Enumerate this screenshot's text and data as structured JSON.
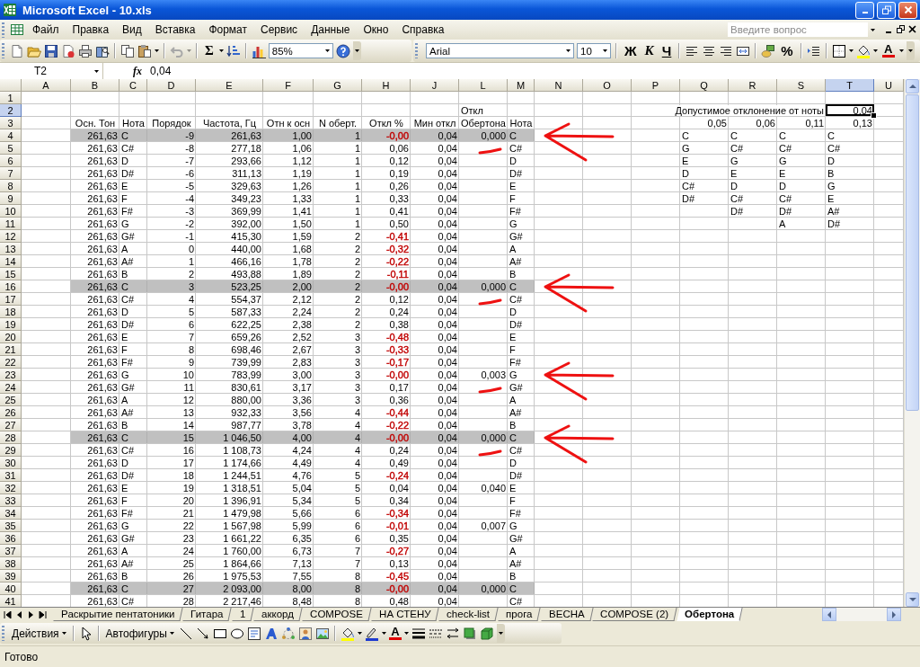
{
  "window": {
    "title": "Microsoft Excel - 10.xls"
  },
  "menu": {
    "items": [
      "Файл",
      "Правка",
      "Вид",
      "Вставка",
      "Формат",
      "Сервис",
      "Данные",
      "Окно",
      "Справка"
    ],
    "help_field": {
      "placeholder": "Введите вопрос"
    }
  },
  "standard_toolbar": {
    "undo_disabled": true,
    "sum": "Σ",
    "zoom": "85%"
  },
  "formatting_toolbar": {
    "font": "Arial",
    "size": "10",
    "bold": "Ж",
    "italic": "К",
    "underline": "Ч",
    "percent": "%",
    "font_color": "A"
  },
  "formula_bar": {
    "name_box": "T2",
    "function_symbol": "fx",
    "formula": "0,04"
  },
  "sheet": {
    "columns": [
      {
        "label": "A",
        "selected": false
      },
      {
        "label": "B",
        "selected": false
      },
      {
        "label": "C",
        "selected": false
      },
      {
        "label": "D",
        "selected": false
      },
      {
        "label": "E",
        "selected": false
      },
      {
        "label": "F",
        "selected": false
      },
      {
        "label": "G",
        "selected": false
      },
      {
        "label": "H",
        "selected": false
      },
      {
        "label": "J",
        "selected": false
      },
      {
        "label": "L",
        "selected": false
      },
      {
        "label": "M",
        "selected": false
      },
      {
        "label": "N",
        "selected": false
      },
      {
        "label": "O",
        "selected": false
      },
      {
        "label": "P",
        "selected": false
      },
      {
        "label": "Q",
        "selected": false
      },
      {
        "label": "R",
        "selected": false
      },
      {
        "label": "S",
        "selected": false
      },
      {
        "label": "T",
        "selected": true
      },
      {
        "label": "U",
        "selected": false
      }
    ],
    "rows": [
      {
        "number": "1",
        "selected": false,
        "highlighted": false
      },
      {
        "number": "2",
        "kind": "data",
        "selected": true,
        "highlighted": false,
        "cells": {
          "L": "Откл",
          "S": "Допустимое отклонение от ноты",
          "T": "0,04"
        }
      },
      {
        "number": "3",
        "kind": "header",
        "selected": false,
        "highlighted": false,
        "cells": {
          "B": "Осн. Тон",
          "C": "Нота",
          "D": "Порядок",
          "E": "Частота, Гц",
          "F": "Отн к осн",
          "G": "N оберт.",
          "H": "Откл %",
          "J": "Мин откл",
          "L": "Обертона",
          "M": "Нота",
          "Q": "0,05",
          "R": "0,06",
          "S": "0,11",
          "T": "0,13"
        }
      },
      {
        "number": "4",
        "kind": "data",
        "selected": false,
        "highlighted": true,
        "annotation": {
          "kind": "arrow"
        },
        "cells": {
          "B": "261,63",
          "C": "C",
          "D": "-9",
          "E": "261,63",
          "F": "1,00",
          "G": "1",
          "H": {
            "text": "-0,00",
            "color": "#c00000"
          },
          "J": "0,04",
          "L": "0,000",
          "M": "C",
          "Q": "C",
          "R": "C",
          "S": "C",
          "T": "C"
        }
      },
      {
        "number": "5",
        "kind": "data",
        "selected": false,
        "highlighted": false,
        "annotation": {
          "kind": "dash"
        },
        "cells": {
          "B": "261,63",
          "C": "C#",
          "D": "-8",
          "E": "277,18",
          "F": "1,06",
          "G": "1",
          "H": "0,06",
          "J": "0,04",
          "M": "C#",
          "Q": "G",
          "R": "C#",
          "S": "C#",
          "T": "C#"
        }
      },
      {
        "number": "6",
        "kind": "data",
        "selected": false,
        "highlighted": false,
        "cells": {
          "B": "261,63",
          "C": "D",
          "D": "-7",
          "E": "293,66",
          "F": "1,12",
          "G": "1",
          "H": "0,12",
          "J": "0,04",
          "M": "D",
          "Q": "E",
          "R": "G",
          "S": "G",
          "T": "D"
        }
      },
      {
        "number": "7",
        "kind": "data",
        "selected": false,
        "highlighted": false,
        "cells": {
          "B": "261,63",
          "C": "D#",
          "D": "-6",
          "E": "311,13",
          "F": "1,19",
          "G": "1",
          "H": "0,19",
          "J": "0,04",
          "M": "D#",
          "Q": "D",
          "R": "E",
          "S": "E",
          "T": "B"
        }
      },
      {
        "number": "8",
        "kind": "data",
        "selected": false,
        "highlighted": false,
        "cells": {
          "B": "261,63",
          "C": "E",
          "D": "-5",
          "E": "329,63",
          "F": "1,26",
          "G": "1",
          "H": "0,26",
          "J": "0,04",
          "M": "E",
          "Q": "C#",
          "R": "D",
          "S": "D",
          "T": "G"
        }
      },
      {
        "number": "9",
        "kind": "data",
        "selected": false,
        "highlighted": false,
        "cells": {
          "B": "261,63",
          "C": "F",
          "D": "-4",
          "E": "349,23",
          "F": "1,33",
          "G": "1",
          "H": "0,33",
          "J": "0,04",
          "M": "F",
          "Q": "D#",
          "R": "C#",
          "S": "C#",
          "T": "E"
        }
      },
      {
        "number": "10",
        "kind": "data",
        "selected": false,
        "highlighted": false,
        "cells": {
          "B": "261,63",
          "C": "F#",
          "D": "-3",
          "E": "369,99",
          "F": "1,41",
          "G": "1",
          "H": "0,41",
          "J": "0,04",
          "M": "F#",
          "R": "D#",
          "S": "D#",
          "T": "A#"
        }
      },
      {
        "number": "11",
        "kind": "data",
        "selected": false,
        "highlighted": false,
        "cells": {
          "B": "261,63",
          "C": "G",
          "D": "-2",
          "E": "392,00",
          "F": "1,50",
          "G": "1",
          "H": "0,50",
          "J": "0,04",
          "M": "G",
          "S": "A",
          "T": "D#"
        }
      },
      {
        "number": "12",
        "kind": "data",
        "selected": false,
        "highlighted": false,
        "cells": {
          "B": "261,63",
          "C": "G#",
          "D": "-1",
          "E": "415,30",
          "F": "1,59",
          "G": "2",
          "H": {
            "text": "-0,41",
            "color": "#c00000"
          },
          "J": "0,04",
          "M": "G#"
        }
      },
      {
        "number": "13",
        "kind": "data",
        "selected": false,
        "highlighted": false,
        "cells": {
          "B": "261,63",
          "C": "A",
          "D": "0",
          "E": "440,00",
          "F": "1,68",
          "G": "2",
          "H": {
            "text": "-0,32",
            "color": "#c00000"
          },
          "J": "0,04",
          "M": "A"
        }
      },
      {
        "number": "14",
        "kind": "data",
        "selected": false,
        "highlighted": false,
        "cells": {
          "B": "261,63",
          "C": "A#",
          "D": "1",
          "E": "466,16",
          "F": "1,78",
          "G": "2",
          "H": {
            "text": "-0,22",
            "color": "#c00000"
          },
          "J": "0,04",
          "M": "A#"
        }
      },
      {
        "number": "15",
        "kind": "data",
        "selected": false,
        "highlighted": false,
        "cells": {
          "B": "261,63",
          "C": "B",
          "D": "2",
          "E": "493,88",
          "F": "1,89",
          "G": "2",
          "H": {
            "text": "-0,11",
            "color": "#c00000"
          },
          "J": "0,04",
          "M": "B"
        }
      },
      {
        "number": "16",
        "kind": "data",
        "selected": false,
        "highlighted": true,
        "annotation": {
          "kind": "arrow"
        },
        "cells": {
          "B": "261,63",
          "C": "C",
          "D": "3",
          "E": "523,25",
          "F": "2,00",
          "G": "2",
          "H": {
            "text": "-0,00",
            "color": "#c00000"
          },
          "J": "0,04",
          "L": "0,000",
          "M": "C"
        }
      },
      {
        "number": "17",
        "kind": "data",
        "selected": false,
        "highlighted": false,
        "annotation": {
          "kind": "dash"
        },
        "cells": {
          "B": "261,63",
          "C": "C#",
          "D": "4",
          "E": "554,37",
          "F": "2,12",
          "G": "2",
          "H": "0,12",
          "J": "0,04",
          "M": "C#"
        }
      },
      {
        "number": "18",
        "kind": "data",
        "selected": false,
        "highlighted": false,
        "cells": {
          "B": "261,63",
          "C": "D",
          "D": "5",
          "E": "587,33",
          "F": "2,24",
          "G": "2",
          "H": "0,24",
          "J": "0,04",
          "M": "D"
        }
      },
      {
        "number": "19",
        "kind": "data",
        "selected": false,
        "highlighted": false,
        "cells": {
          "B": "261,63",
          "C": "D#",
          "D": "6",
          "E": "622,25",
          "F": "2,38",
          "G": "2",
          "H": "0,38",
          "J": "0,04",
          "M": "D#"
        }
      },
      {
        "number": "20",
        "kind": "data",
        "selected": false,
        "highlighted": false,
        "cells": {
          "B": "261,63",
          "C": "E",
          "D": "7",
          "E": "659,26",
          "F": "2,52",
          "G": "3",
          "H": {
            "text": "-0,48",
            "color": "#c00000"
          },
          "J": "0,04",
          "M": "E"
        }
      },
      {
        "number": "21",
        "kind": "data",
        "selected": false,
        "highlighted": false,
        "cells": {
          "B": "261,63",
          "C": "F",
          "D": "8",
          "E": "698,46",
          "F": "2,67",
          "G": "3",
          "H": {
            "text": "-0,33",
            "color": "#c00000"
          },
          "J": "0,04",
          "M": "F"
        }
      },
      {
        "number": "22",
        "kind": "data",
        "selected": false,
        "highlighted": false,
        "cells": {
          "B": "261,63",
          "C": "F#",
          "D": "9",
          "E": "739,99",
          "F": "2,83",
          "G": "3",
          "H": {
            "text": "-0,17",
            "color": "#c00000"
          },
          "J": "0,04",
          "M": "F#"
        }
      },
      {
        "number": "23",
        "kind": "data",
        "selected": false,
        "highlighted": false,
        "annotation": {
          "kind": "arrow"
        },
        "cells": {
          "B": "261,63",
          "C": "G",
          "D": "10",
          "E": "783,99",
          "F": "3,00",
          "G": "3",
          "H": {
            "text": "-0,00",
            "color": "#c00000"
          },
          "J": "0,04",
          "L": "0,003",
          "M": "G"
        }
      },
      {
        "number": "24",
        "kind": "data",
        "selected": false,
        "highlighted": false,
        "annotation": {
          "kind": "dash"
        },
        "cells": {
          "B": "261,63",
          "C": "G#",
          "D": "11",
          "E": "830,61",
          "F": "3,17",
          "G": "3",
          "H": "0,17",
          "J": "0,04",
          "M": "G#"
        }
      },
      {
        "number": "25",
        "kind": "data",
        "selected": false,
        "highlighted": false,
        "cells": {
          "B": "261,63",
          "C": "A",
          "D": "12",
          "E": "880,00",
          "F": "3,36",
          "G": "3",
          "H": "0,36",
          "J": "0,04",
          "M": "A"
        }
      },
      {
        "number": "26",
        "kind": "data",
        "selected": false,
        "highlighted": false,
        "cells": {
          "B": "261,63",
          "C": "A#",
          "D": "13",
          "E": "932,33",
          "F": "3,56",
          "G": "4",
          "H": {
            "text": "-0,44",
            "color": "#c00000"
          },
          "J": "0,04",
          "M": "A#"
        }
      },
      {
        "number": "27",
        "kind": "data",
        "selected": false,
        "highlighted": false,
        "cells": {
          "B": "261,63",
          "C": "B",
          "D": "14",
          "E": "987,77",
          "F": "3,78",
          "G": "4",
          "H": {
            "text": "-0,22",
            "color": "#c00000"
          },
          "J": "0,04",
          "M": "B"
        }
      },
      {
        "number": "28",
        "kind": "data",
        "selected": false,
        "highlighted": true,
        "annotation": {
          "kind": "arrow"
        },
        "cells": {
          "B": "261,63",
          "C": "C",
          "D": "15",
          "E": "1 046,50",
          "F": "4,00",
          "G": "4",
          "H": {
            "text": "-0,00",
            "color": "#c00000"
          },
          "J": "0,04",
          "L": "0,000",
          "M": "C"
        }
      },
      {
        "number": "29",
        "kind": "data",
        "selected": false,
        "highlighted": false,
        "annotation": {
          "kind": "dash"
        },
        "cells": {
          "B": "261,63",
          "C": "C#",
          "D": "16",
          "E": "1 108,73",
          "F": "4,24",
          "G": "4",
          "H": "0,24",
          "J": "0,04",
          "M": "C#"
        }
      },
      {
        "number": "30",
        "kind": "data",
        "selected": false,
        "highlighted": false,
        "cells": {
          "B": "261,63",
          "C": "D",
          "D": "17",
          "E": "1 174,66",
          "F": "4,49",
          "G": "4",
          "H": "0,49",
          "J": "0,04",
          "M": "D"
        }
      },
      {
        "number": "31",
        "kind": "data",
        "selected": false,
        "highlighted": false,
        "cells": {
          "B": "261,63",
          "C": "D#",
          "D": "18",
          "E": "1 244,51",
          "F": "4,76",
          "G": "5",
          "H": {
            "text": "-0,24",
            "color": "#c00000"
          },
          "J": "0,04",
          "M": "D#"
        }
      },
      {
        "number": "32",
        "kind": "data",
        "selected": false,
        "highlighted": false,
        "cells": {
          "B": "261,63",
          "C": "E",
          "D": "19",
          "E": "1 318,51",
          "F": "5,04",
          "G": "5",
          "H": "0,04",
          "J": "0,04",
          "L": "0,040",
          "M": "E"
        }
      },
      {
        "number": "33",
        "kind": "data",
        "selected": false,
        "highlighted": false,
        "cells": {
          "B": "261,63",
          "C": "F",
          "D": "20",
          "E": "1 396,91",
          "F": "5,34",
          "G": "5",
          "H": "0,34",
          "J": "0,04",
          "M": "F"
        }
      },
      {
        "number": "34",
        "kind": "data",
        "selected": false,
        "highlighted": false,
        "cells": {
          "B": "261,63",
          "C": "F#",
          "D": "21",
          "E": "1 479,98",
          "F": "5,66",
          "G": "6",
          "H": {
            "text": "-0,34",
            "color": "#c00000"
          },
          "J": "0,04",
          "M": "F#"
        }
      },
      {
        "number": "35",
        "kind": "data",
        "selected": false,
        "highlighted": false,
        "cells": {
          "B": "261,63",
          "C": "G",
          "D": "22",
          "E": "1 567,98",
          "F": "5,99",
          "G": "6",
          "H": {
            "text": "-0,01",
            "color": "#c00000"
          },
          "J": "0,04",
          "L": "0,007",
          "M": "G"
        }
      },
      {
        "number": "36",
        "kind": "data",
        "selected": false,
        "highlighted": false,
        "cells": {
          "B": "261,63",
          "C": "G#",
          "D": "23",
          "E": "1 661,22",
          "F": "6,35",
          "G": "6",
          "H": "0,35",
          "J": "0,04",
          "M": "G#"
        }
      },
      {
        "number": "37",
        "kind": "data",
        "selected": false,
        "highlighted": false,
        "cells": {
          "B": "261,63",
          "C": "A",
          "D": "24",
          "E": "1 760,00",
          "F": "6,73",
          "G": "7",
          "H": {
            "text": "-0,27",
            "color": "#c00000"
          },
          "J": "0,04",
          "M": "A"
        }
      },
      {
        "number": "38",
        "kind": "data",
        "selected": false,
        "highlighted": false,
        "cells": {
          "B": "261,63",
          "C": "A#",
          "D": "25",
          "E": "1 864,66",
          "F": "7,13",
          "G": "7",
          "H": "0,13",
          "J": "0,04",
          "M": "A#"
        }
      },
      {
        "number": "39",
        "kind": "data",
        "selected": false,
        "highlighted": false,
        "cells": {
          "B": "261,63",
          "C": "B",
          "D": "26",
          "E": "1 975,53",
          "F": "7,55",
          "G": "8",
          "H": {
            "text": "-0,45",
            "color": "#c00000"
          },
          "J": "0,04",
          "M": "B"
        }
      },
      {
        "number": "40",
        "kind": "data",
        "selected": false,
        "highlighted": true,
        "cells": {
          "B": "261,63",
          "C": "C",
          "D": "27",
          "E": "2 093,00",
          "F": "8,00",
          "G": "8",
          "H": {
            "text": "-0,00",
            "color": "#c00000"
          },
          "J": "0,04",
          "L": "0,000",
          "M": "C"
        }
      },
      {
        "number": "41",
        "kind": "data",
        "selected": false,
        "highlighted": false,
        "cells": {
          "B": "261,63",
          "C": "C#",
          "D": "28",
          "E": "2 217,46",
          "F": "8,48",
          "G": "8",
          "H": "0,48",
          "J": "0,04",
          "M": "C#"
        }
      }
    ]
  },
  "sheet_tabs": [
    {
      "label": "Раскрытие пентатоники",
      "selected": false
    },
    {
      "label": "Гитара",
      "selected": false
    },
    {
      "label": "1",
      "selected": false
    },
    {
      "label": "аккорд",
      "selected": false
    },
    {
      "label": "COMPOSE",
      "selected": false
    },
    {
      "label": "НА СТЕНУ",
      "selected": false
    },
    {
      "label": "check-list",
      "selected": false
    },
    {
      "label": "прога",
      "selected": false
    },
    {
      "label": "ВЕСНА",
      "selected": false
    },
    {
      "label": "COMPOSE (2)",
      "selected": false
    },
    {
      "label": "Обертона",
      "selected": true
    }
  ],
  "drawing_toolbar": {
    "actions": "Действия",
    "autoshapes": "Автофигуры",
    "font_color": "A"
  },
  "status_bar": {
    "text": "Готово"
  }
}
